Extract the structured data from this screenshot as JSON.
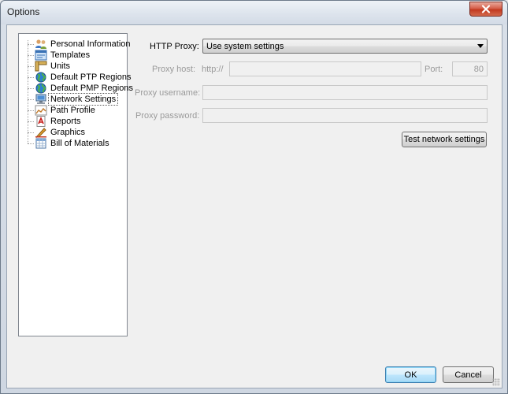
{
  "window": {
    "title": "Options"
  },
  "tree": {
    "items": [
      {
        "label": "Personal Information",
        "icon": "user-group-icon"
      },
      {
        "label": "Templates",
        "icon": "template-icon"
      },
      {
        "label": "Units",
        "icon": "ruler-icon"
      },
      {
        "label": "Default PTP Regions",
        "icon": "globe-icon"
      },
      {
        "label": "Default PMP Regions",
        "icon": "globe-icon"
      },
      {
        "label": "Network Settings",
        "icon": "network-computer-icon",
        "selected": true
      },
      {
        "label": "Path Profile",
        "icon": "path-profile-icon"
      },
      {
        "label": "Reports",
        "icon": "pdf-report-icon"
      },
      {
        "label": "Graphics",
        "icon": "pencil-ruler-icon"
      },
      {
        "label": "Bill of Materials",
        "icon": "spreadsheet-icon"
      }
    ]
  },
  "network": {
    "http_proxy_label": "HTTP Proxy:",
    "http_proxy_value": "Use system settings",
    "proxy_host_label": "Proxy host:",
    "proxy_host_prefix": "http://",
    "proxy_host_value": "",
    "port_label": "Port:",
    "port_value": "80",
    "proxy_username_label": "Proxy username:",
    "proxy_username_value": "",
    "proxy_password_label": "Proxy password:",
    "proxy_password_value": "",
    "test_button": "Test network settings"
  },
  "footer": {
    "ok": "OK",
    "cancel": "Cancel"
  },
  "colors": {
    "close_button": "#c9452e",
    "selection_outline": "#555555",
    "disabled_text": "#9a9a9a"
  }
}
